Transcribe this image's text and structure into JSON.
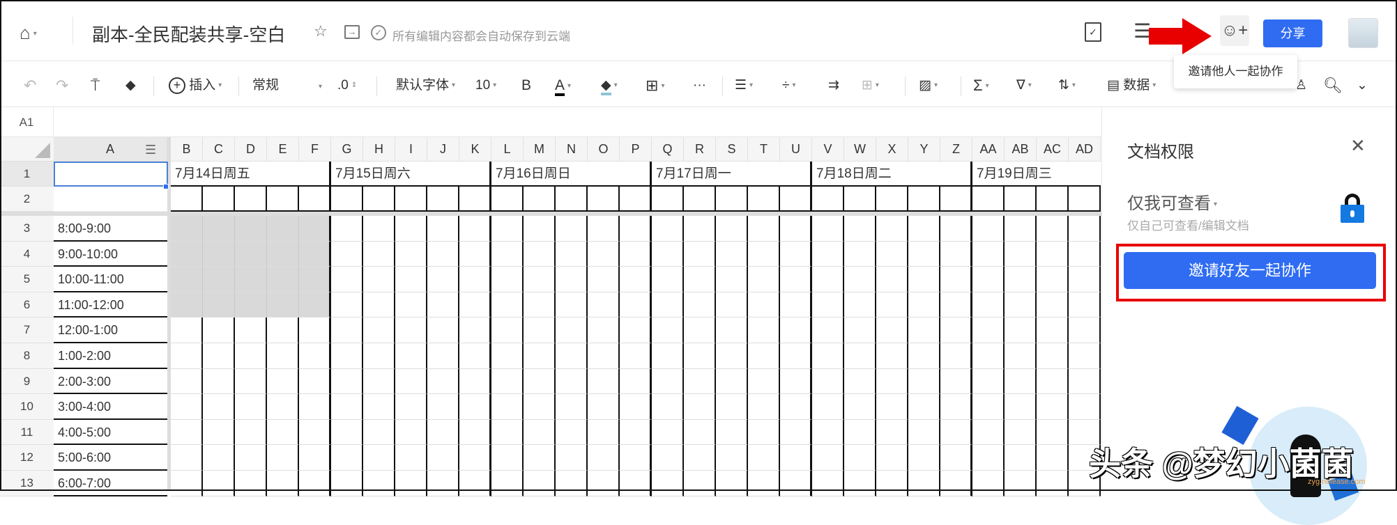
{
  "header": {
    "title": "副本-全民配装共享-空白",
    "save_status": "所有编辑内容都会自动保存到云端",
    "share_label": "分享",
    "tooltip": "邀请他人一起协作"
  },
  "toolbar": {
    "insert": "插入",
    "format": "常规",
    "decimal": ".0",
    "font": "默认字体",
    "size": "10",
    "bold": "B",
    "font_color": "A",
    "data": "数据",
    "font_color_value": "#000000",
    "fill_color_value": "#8fc5d6"
  },
  "formula_bar": {
    "cell_ref": "A1",
    "value": ""
  },
  "sheet": {
    "columns": [
      "B",
      "C",
      "D",
      "E",
      "F",
      "G",
      "H",
      "I",
      "J",
      "K",
      "L",
      "M",
      "N",
      "O",
      "P",
      "Q",
      "R",
      "S",
      "T",
      "U",
      "V",
      "W",
      "X",
      "Y",
      "Z",
      "AA",
      "AB",
      "AC",
      "AD"
    ],
    "col_a": "A",
    "row_numbers": [
      "1",
      "2",
      "3",
      "4",
      "5",
      "6",
      "7",
      "8",
      "9",
      "10",
      "11",
      "12",
      "13"
    ],
    "days": [
      "7月14日周五",
      "7月15日周六",
      "7月16日周日",
      "7月17日周一",
      "7月18日周二",
      "7月19日周三"
    ],
    "time_slots": [
      "8:00-9:00",
      "9:00-10:00",
      "10:00-11:00",
      "11:00-12:00",
      "12:00-1:00",
      "1:00-2:00",
      "2:00-3:00",
      "3:00-4:00",
      "4:00-5:00",
      "5:00-6:00",
      "6:00-7:00"
    ]
  },
  "panel": {
    "title": "文档权限",
    "permission": "仅我可查看",
    "permission_desc": "仅自己可查看/编辑文档",
    "invite_button": "邀请好友一起协作",
    "accent": "#2f6cf2"
  },
  "watermark": {
    "text": "头条 @梦幻小菌菌",
    "site": "zyg.nolease.com"
  }
}
